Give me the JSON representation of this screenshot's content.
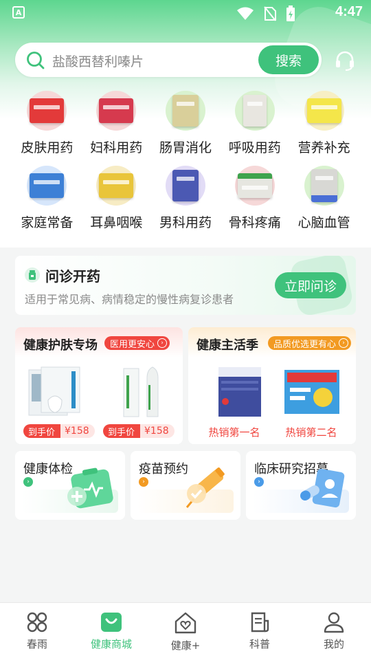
{
  "colors": {
    "accent": "#3fc27c",
    "promo_red": "#f0463f",
    "promo_orange": "#f29a22"
  },
  "status_bar": {
    "app_badge": "A",
    "time": "4:47"
  },
  "search": {
    "placeholder": "盐酸西替利嗪片",
    "button": "搜索"
  },
  "categories": [
    {
      "label": "皮肤用药",
      "icon": "medicine-box-icon",
      "color": "#f6d8d8",
      "box": "#e33a3a"
    },
    {
      "label": "妇科用药",
      "icon": "medicine-box-icon",
      "color": "#f6d8d8",
      "box": "#d63a4e"
    },
    {
      "label": "肠胃消化",
      "icon": "medicine-box-icon",
      "color": "#d9f2cf",
      "box": "#d9cf9a"
    },
    {
      "label": "呼吸用药",
      "icon": "medicine-box-icon",
      "color": "#d9f2cf",
      "box": "#e8e6e0"
    },
    {
      "label": "营养补充",
      "icon": "medicine-box-icon",
      "color": "#f7efc4",
      "box": "#f4e64a"
    },
    {
      "label": "家庭常备",
      "icon": "medicine-box-icon",
      "color": "#d6e6fb",
      "box": "#3d80d6"
    },
    {
      "label": "耳鼻咽喉",
      "icon": "medicine-box-icon",
      "color": "#f7ecc4",
      "box": "#e9c53a"
    },
    {
      "label": "男科用药",
      "icon": "medicine-box-icon",
      "color": "#e2dcf6",
      "box": "#4b59b3"
    },
    {
      "label": "骨科疼痛",
      "icon": "medicine-box-icon",
      "color": "#f6d8d8",
      "box": "#e6e6e0"
    },
    {
      "label": "心脑血管",
      "icon": "medicine-box-icon",
      "color": "#d9f2cf",
      "box": "#d8d8d4"
    }
  ],
  "consult": {
    "title": "问诊开药",
    "subtitle": "适用于常见病、病情稳定的慢性病复诊患者",
    "cta": "立即问诊"
  },
  "promo_left": {
    "title": "健康护肤专场",
    "tag": "医用更安心",
    "items": [
      {
        "price_label": "到手价",
        "price": "¥158"
      },
      {
        "price_label": "到手价",
        "price": "¥158"
      }
    ]
  },
  "promo_right": {
    "title": "健康主活季",
    "tag": "品质优选更有心",
    "items": [
      {
        "rank": "热销第一名"
      },
      {
        "rank": "热销第二名"
      }
    ]
  },
  "services": [
    {
      "title": "健康体检",
      "icon": "health-checkup-icon",
      "tint": "#e8f7ee",
      "dot": "#3fc27c"
    },
    {
      "title": "疫苗预约",
      "icon": "vaccine-syringe-icon",
      "tint": "#fdf3e2",
      "dot": "#f29a22"
    },
    {
      "title": "临床研究招募",
      "icon": "clinical-recruit-icon",
      "tint": "#e6f0fb",
      "dot": "#4a9be8"
    }
  ],
  "bottom_nav": [
    {
      "label": "春雨",
      "icon": "grid-icon"
    },
    {
      "label": "健康商城",
      "icon": "shopping-bag-icon",
      "active": true
    },
    {
      "label": "健康+",
      "icon": "home-heart-icon"
    },
    {
      "label": "科普",
      "icon": "article-icon"
    },
    {
      "label": "我的",
      "icon": "user-icon"
    }
  ]
}
